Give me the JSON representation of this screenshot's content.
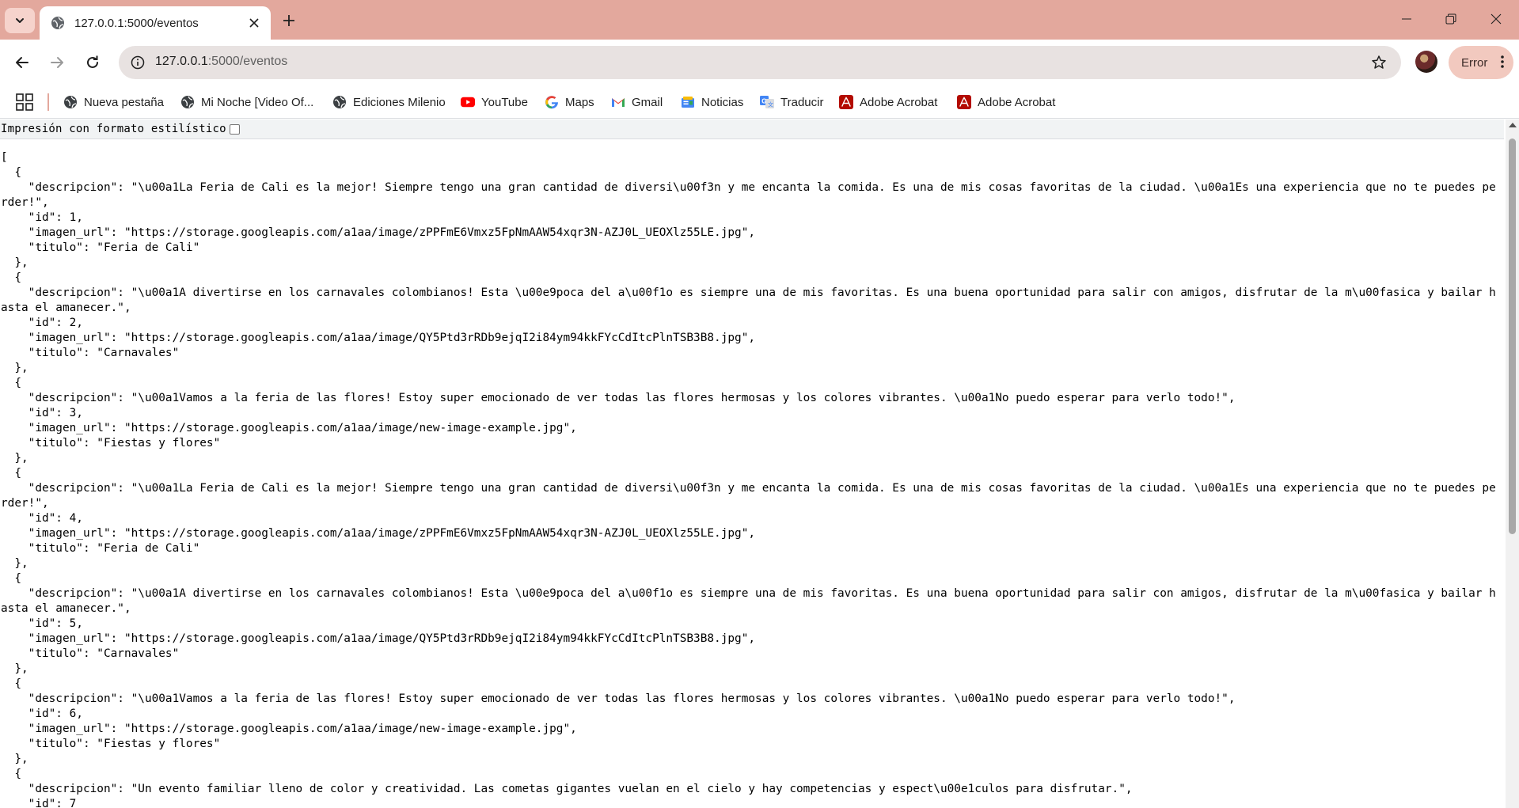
{
  "colors": {
    "frame": "#e3a89d",
    "omnibox": "#e8e2e1",
    "error_pill": "#f2c9bf",
    "youtube_red": "#ff0000",
    "acrobat_red": "#b30b00"
  },
  "tab": {
    "title": "127.0.0.1:5000/eventos",
    "favicon": "globe-icon"
  },
  "address_bar": {
    "host": "127.0.0.1",
    "path": ":5000/eventos"
  },
  "profile": {
    "error_label": "Error"
  },
  "bookmarks": [
    {
      "label": "Nueva pestaña",
      "icon": "globe-icon"
    },
    {
      "label": "Mi Noche [Video Of...",
      "icon": "globe-icon"
    },
    {
      "label": "Ediciones Milenio",
      "icon": "globe-icon"
    },
    {
      "label": "YouTube",
      "icon": "youtube-icon"
    },
    {
      "label": "Maps",
      "icon": "google-icon"
    },
    {
      "label": "Gmail",
      "icon": "gmail-icon"
    },
    {
      "label": "Noticias",
      "icon": "news-icon"
    },
    {
      "label": "Traducir",
      "icon": "translate-icon"
    },
    {
      "label": "Adobe Acrobat",
      "icon": "acrobat-icon"
    },
    {
      "label": "Adobe Acrobat",
      "icon": "acrobat-icon"
    }
  ],
  "pretty_print": {
    "label": "Impresión con formato estilístico"
  },
  "json_text": "[\n  {\n    \"descripcion\": \"\\u00a1La Feria de Cali es la mejor! Siempre tengo una gran cantidad de diversi\\u00f3n y me encanta la comida. Es una de mis cosas favoritas de la ciudad. \\u00a1Es una experiencia que no te puedes perder!\",\n    \"id\": 1,\n    \"imagen_url\": \"https://storage.googleapis.com/a1aa/image/zPPFmE6Vmxz5FpNmAAW54xqr3N-AZJ0L_UEOXlz55LE.jpg\",\n    \"titulo\": \"Feria de Cali\"\n  },\n  {\n    \"descripcion\": \"\\u00a1A divertirse en los carnavales colombianos! Esta \\u00e9poca del a\\u00f1o es siempre una de mis favoritas. Es una buena oportunidad para salir con amigos, disfrutar de la m\\u00fasica y bailar hasta el amanecer.\",\n    \"id\": 2,\n    \"imagen_url\": \"https://storage.googleapis.com/a1aa/image/QY5Ptd3rRDb9ejqI2i84ym94kkFYcCdItcPlnTSB3B8.jpg\",\n    \"titulo\": \"Carnavales\"\n  },\n  {\n    \"descripcion\": \"\\u00a1Vamos a la feria de las flores! Estoy super emocionado de ver todas las flores hermosas y los colores vibrantes. \\u00a1No puedo esperar para verlo todo!\",\n    \"id\": 3,\n    \"imagen_url\": \"https://storage.googleapis.com/a1aa/image/new-image-example.jpg\",\n    \"titulo\": \"Fiestas y flores\"\n  },\n  {\n    \"descripcion\": \"\\u00a1La Feria de Cali es la mejor! Siempre tengo una gran cantidad de diversi\\u00f3n y me encanta la comida. Es una de mis cosas favoritas de la ciudad. \\u00a1Es una experiencia que no te puedes perder!\",\n    \"id\": 4,\n    \"imagen_url\": \"https://storage.googleapis.com/a1aa/image/zPPFmE6Vmxz5FpNmAAW54xqr3N-AZJ0L_UEOXlz55LE.jpg\",\n    \"titulo\": \"Feria de Cali\"\n  },\n  {\n    \"descripcion\": \"\\u00a1A divertirse en los carnavales colombianos! Esta \\u00e9poca del a\\u00f1o es siempre una de mis favoritas. Es una buena oportunidad para salir con amigos, disfrutar de la m\\u00fasica y bailar hasta el amanecer.\",\n    \"id\": 5,\n    \"imagen_url\": \"https://storage.googleapis.com/a1aa/image/QY5Ptd3rRDb9ejqI2i84ym94kkFYcCdItcPlnTSB3B8.jpg\",\n    \"titulo\": \"Carnavales\"\n  },\n  {\n    \"descripcion\": \"\\u00a1Vamos a la feria de las flores! Estoy super emocionado de ver todas las flores hermosas y los colores vibrantes. \\u00a1No puedo esperar para verlo todo!\",\n    \"id\": 6,\n    \"imagen_url\": \"https://storage.googleapis.com/a1aa/image/new-image-example.jpg\",\n    \"titulo\": \"Fiestas y flores\"\n  },\n  {\n    \"descripcion\": \"Un evento familiar lleno de color y creatividad. Las cometas gigantes vuelan en el cielo y hay competencias y espect\\u00e1culos para disfrutar.\",\n    \"id\": 7"
}
